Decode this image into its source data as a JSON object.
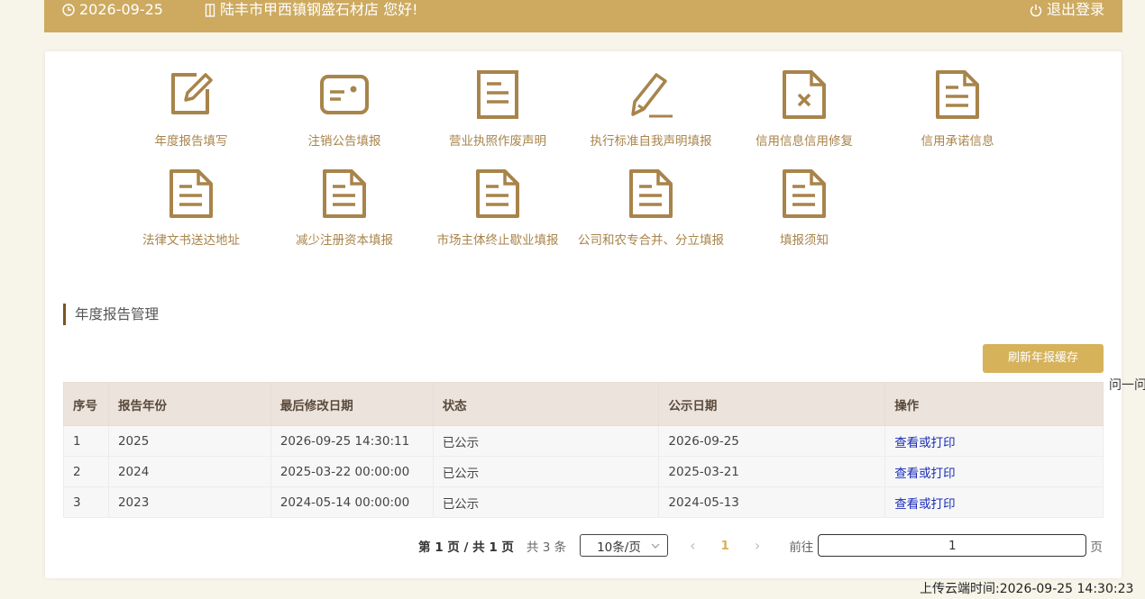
{
  "header": {
    "date": "2026-09-25",
    "welcome": "陆丰市甲西镇钢盛石材店 您好!",
    "logout": "退出登录"
  },
  "tiles": [
    {
      "label": "年度报告填写",
      "icon": "edit-icon"
    },
    {
      "label": "注销公告填报",
      "icon": "id-card-icon"
    },
    {
      "label": "营业执照作废声明",
      "icon": "document-icon"
    },
    {
      "label": "执行标准自我声明填报",
      "icon": "pencil-icon"
    },
    {
      "label": "信用信息信用修复",
      "icon": "document-x-icon"
    },
    {
      "label": "信用承诺信息",
      "icon": "document-icon"
    },
    {
      "label": "法律文书送达地址",
      "icon": "document-icon"
    },
    {
      "label": "减少注册资本填报",
      "icon": "document-icon"
    },
    {
      "label": "市场主体终止歇业填报",
      "icon": "document-icon"
    },
    {
      "label": "公司和农专合并、分立填报",
      "icon": "document-icon"
    },
    {
      "label": "填报须知",
      "icon": "document-icon"
    }
  ],
  "section": {
    "title": "年度报告管理",
    "refresh_button": "刷新年报缓存"
  },
  "table": {
    "columns": [
      "序号",
      "报告年份",
      "最后修改日期",
      "状态",
      "公示日期",
      "操作"
    ],
    "rows": [
      [
        "1",
        "2025",
        "2026-09-25 14:30:11",
        "已公示",
        "2026-09-25",
        "查看或打印"
      ],
      [
        "2",
        "2024",
        "2025-03-22 00:00:00",
        "已公示",
        "2025-03-21",
        "查看或打印"
      ],
      [
        "3",
        "2023",
        "2024-05-14 00:00:00",
        "已公示",
        "2024-05-13",
        "查看或打印"
      ]
    ]
  },
  "pagination": {
    "summary": "第 1 页 / 共 1 页",
    "total": "共 3 条",
    "page_size": "10条/页",
    "prev": "‹",
    "current": "1",
    "next": "›",
    "goto_label": "前往",
    "goto_value": "1",
    "page_word": "页"
  },
  "side_text": "问一问",
  "upload_time": "上传云端时间:2026-09-25 14:30:23",
  "colors": {
    "brand": "#cdaa60",
    "icon": "#a8844b",
    "button": "#d6b25b",
    "link": "#1a2db8"
  }
}
